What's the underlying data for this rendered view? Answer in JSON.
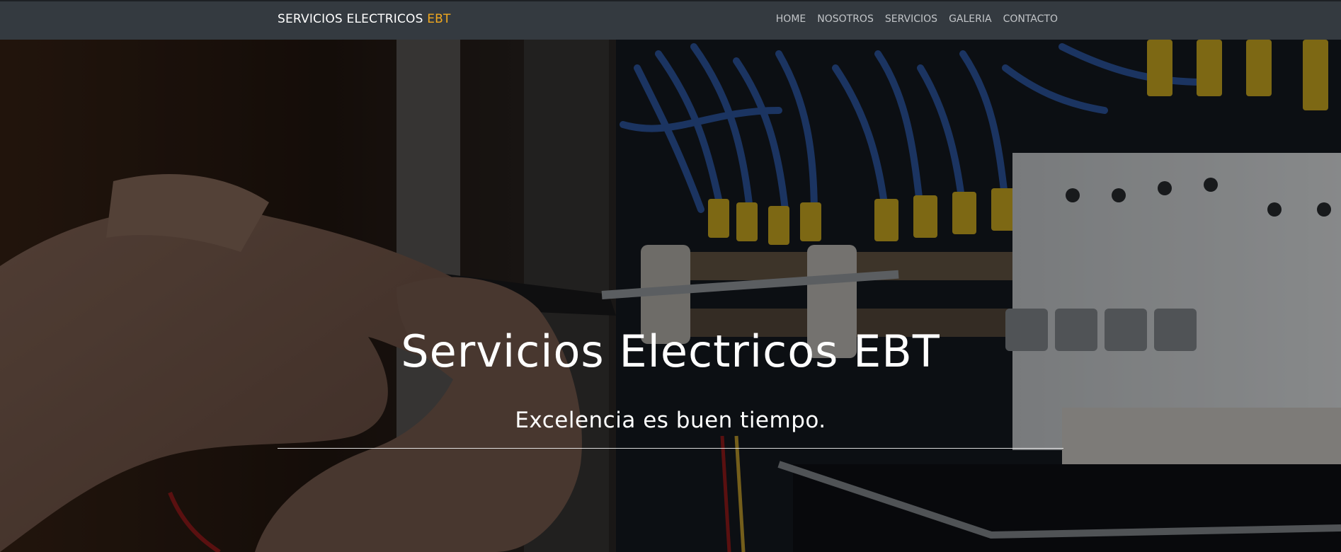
{
  "navbar": {
    "brand_main": "SERVICIOS ELECTRICOS ",
    "brand_accent": "EBT",
    "accent_color": "#f0a820",
    "background": "#343a40",
    "links": [
      {
        "label": "HOME"
      },
      {
        "label": "NOSOTROS"
      },
      {
        "label": "SERVICIOS"
      },
      {
        "label": "GALERIA"
      },
      {
        "label": "CONTACTO"
      }
    ]
  },
  "hero": {
    "background_image": "electrician-screwdriver-panel-photo",
    "title": "Servicios Electricos EBT",
    "subtitle": "Excelencia es buen tiempo."
  }
}
